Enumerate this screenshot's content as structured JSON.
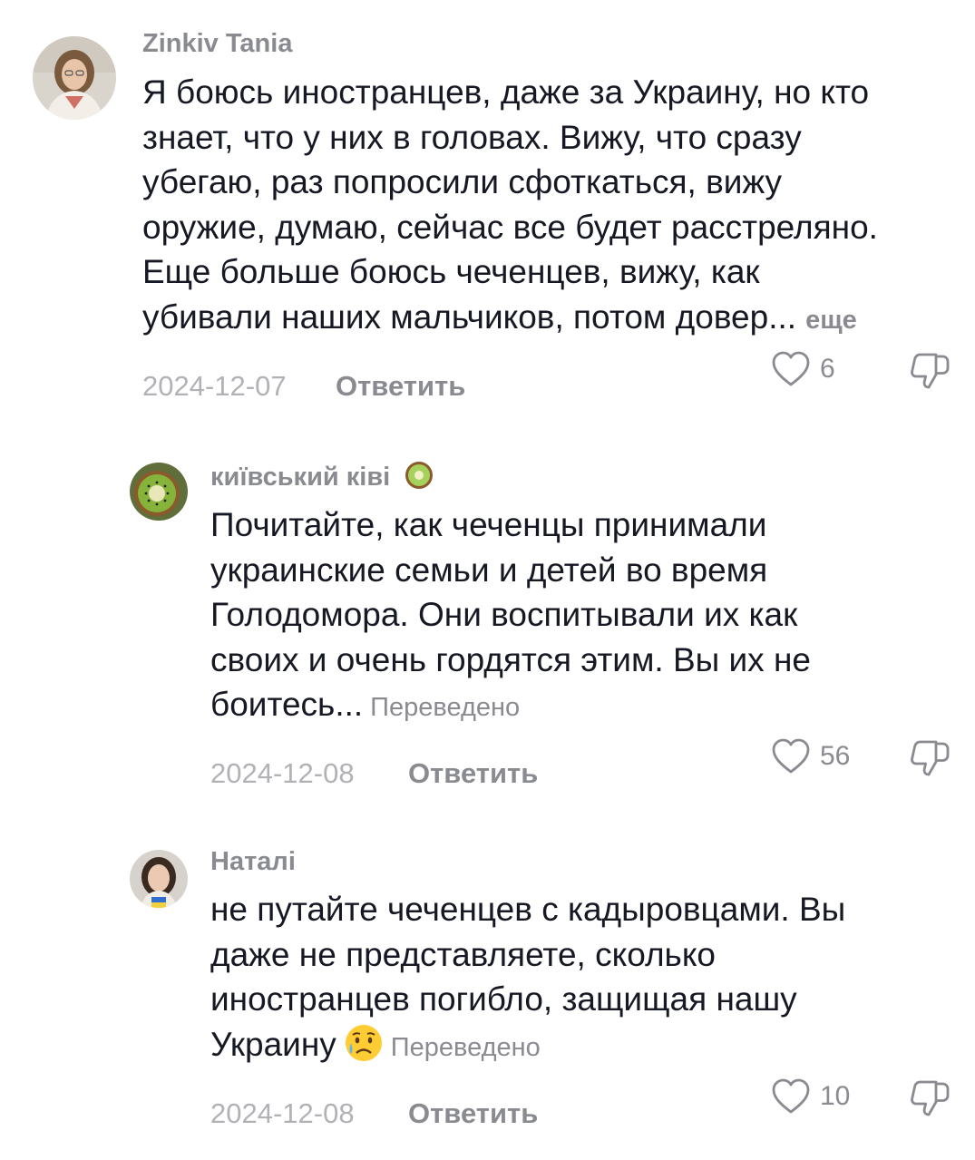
{
  "comments": [
    {
      "username": "Zinkiv Tania",
      "text_lines": [
        "Я боюсь иностранцев, даже за Украину, но кто",
        "знает, что у них в головах. Вижу, что сразу",
        "убегаю, раз попросили сфоткаться, вижу",
        "оружие, думаю, сейчас все будет расстреляно.",
        "Еще больше боюсь чеченцев, вижу, как",
        "убивали наших мальчиков, потом довер..."
      ],
      "more_label": "еще",
      "date": "2024-12-07",
      "reply_label": "Ответить",
      "likes": "6"
    },
    {
      "username": "київський ківі",
      "username_emoji": "kiwi-emoji",
      "text_lines": [
        "Почитайте, как чеченцы принимали",
        "украинские семьи и детей во время",
        "Голодомора. Они воспитывали их как",
        "своих и очень гордятся этим. Вы их не",
        "боитесь..."
      ],
      "translated_label": "Переведено",
      "date": "2024-12-08",
      "reply_label": "Ответить",
      "likes": "56"
    },
    {
      "username": "Наталі",
      "text_lines": [
        "не путайте чеченцев с кадыровцами. Вы",
        "даже не представляете, сколько",
        "иностранцев погибло, защищая нашу",
        "Украину"
      ],
      "text_emoji": "sad-relieved-face-emoji",
      "translated_label": "Переведено",
      "date": "2024-12-08",
      "reply_label": "Ответить",
      "likes": "10"
    }
  ],
  "icons": {
    "like": "heart-outline-icon",
    "dislike": "thumbs-down-outline-icon"
  },
  "colors": {
    "text": "#161823",
    "secondary": "#8a8b91",
    "date": "#b1b2b6"
  }
}
